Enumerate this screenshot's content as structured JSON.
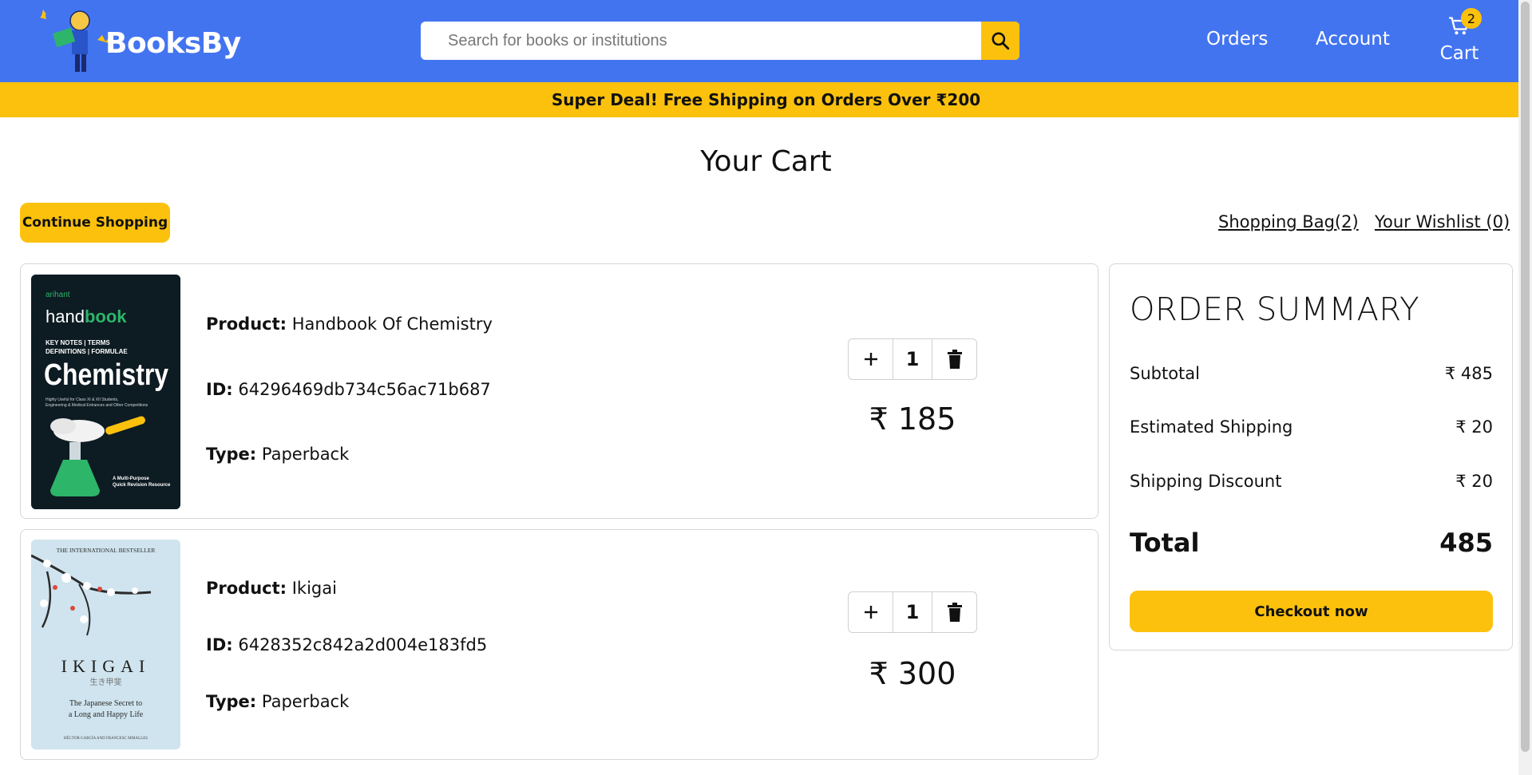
{
  "header": {
    "brand": "BooksBy",
    "search": {
      "placeholder": "Search for books or institutions",
      "value": ""
    },
    "nav": {
      "orders": "Orders",
      "account": "Account",
      "cart_label": "Cart",
      "cart_count": "2"
    }
  },
  "banner": {
    "text": "Super Deal! Free Shipping on Orders Over ₹200"
  },
  "page": {
    "title": "Your Cart",
    "continue_label": "Continue Shopping",
    "shopping_bag": "Shopping Bag(2)",
    "wishlist": "Your Wishlist (0)"
  },
  "labels": {
    "product": "Product:",
    "id": "ID:",
    "type": "Type:"
  },
  "items": [
    {
      "product": "Handbook Of Chemistry",
      "id": "64296469db734c56ac71b687",
      "type": "Paperback",
      "quantity": "1",
      "price": "₹ 185",
      "cover": {
        "publisher": "arihant",
        "series_light": "hand",
        "series_bold": "book",
        "tag1": "KEY NOTES | TERMS",
        "tag2": "DEFINITIONS | FORMULAE",
        "subject": "Chemistry",
        "blurb1": "Highly Useful for Class XI & XII Students,",
        "blurb2": "Engineering & Medical Entrances and Other Competitions",
        "footer1": "A Multi-Purpose",
        "footer2": "Quick Revision Resource"
      }
    },
    {
      "product": "Ikigai",
      "id": "6428352c842a2d004e183fd5",
      "type": "Paperback",
      "quantity": "1",
      "price": "₹ 300",
      "cover": {
        "top": "THE INTERNATIONAL BESTSELLER",
        "title": "IKIGAI",
        "kanji": "生き甲斐",
        "sub1": "The Japanese Secret to",
        "sub2": "a Long and Happy Life",
        "authors": "HÉCTOR GARCÍA AND FRANCESC MIRALLES"
      }
    }
  ],
  "summary": {
    "title": "ORDER SUMMARY",
    "rows": [
      {
        "label": "Subtotal",
        "value": "₹ 485"
      },
      {
        "label": "Estimated Shipping",
        "value": "₹ 20"
      },
      {
        "label": "Shipping Discount",
        "value": "₹ 20"
      }
    ],
    "total_label": "Total",
    "total_value": "485",
    "checkout_label": "Checkout now"
  },
  "colors": {
    "header_blue": "#4374f0",
    "accent_yellow": "#fcc10c"
  },
  "icons": [
    "search-icon",
    "cart-icon",
    "plus-icon",
    "trash-icon"
  ]
}
